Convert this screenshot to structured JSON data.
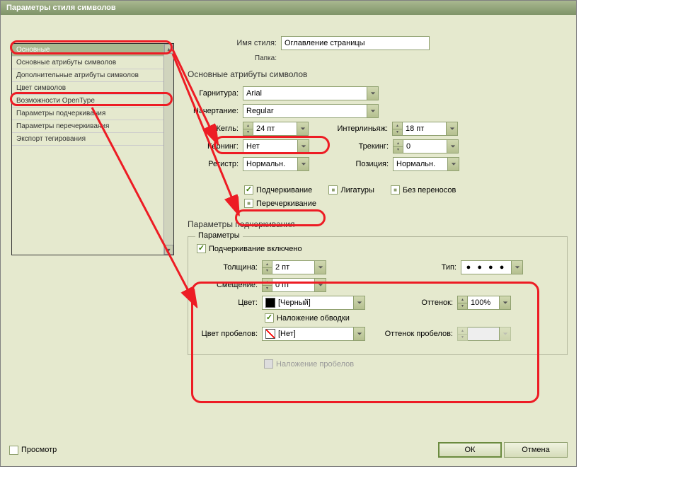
{
  "window": {
    "title": "Параметры стиля символов"
  },
  "sidebar": {
    "items": [
      {
        "label": "Основные"
      },
      {
        "label": "Основные атрибуты символов"
      },
      {
        "label": "Дополнительные атрибуты символов"
      },
      {
        "label": "Цвет символов"
      },
      {
        "label": "Возможности OpenType"
      },
      {
        "label": "Параметры подчеркивания"
      },
      {
        "label": "Параметры перечеркивания"
      },
      {
        "label": "Экспорт тегирования"
      }
    ]
  },
  "header": {
    "styleNameLabel": "Имя стиля:",
    "styleName": "Оглавление страницы",
    "folderLabel": "Папка:",
    "folder": ""
  },
  "sectionA": {
    "title": "Основные атрибуты символов",
    "fontLabel": "Гарнитура:",
    "font": "Arial",
    "styleLabel": "Начертание:",
    "style": "Regular",
    "sizeLabel": "Кегль:",
    "size": "24 пт",
    "leadingLabel": "Интерлиньяж:",
    "leading": "18 пт",
    "kerningLabel": "Кернинг:",
    "kerning": "Нет",
    "trackingLabel": "Трекинг:",
    "tracking": "0",
    "caseLabel": "Регистр:",
    "case": "Нормальн.",
    "positionLabel": "Позиция:",
    "position": "Нормальн.",
    "cb_underline": "Подчеркивание",
    "cb_ligatures": "Лигатуры",
    "cb_nobreak": "Без переносов",
    "cb_strike": "Перечеркивание"
  },
  "sectionB": {
    "title": "Параметры подчеркивания",
    "legend": "Параметры",
    "cb_on": "Подчеркивание включено",
    "weightLabel": "Толщина:",
    "weight": "2 пт",
    "offsetLabel": "Смещение:",
    "offset": "0 пт",
    "typeLabel": "Тип:",
    "colorLabel": "Цвет:",
    "color": "[Черный]",
    "tintLabel": "Оттенок:",
    "tint": "100%",
    "cb_overprint": "Наложение обводки",
    "gapColorLabel": "Цвет пробелов:",
    "gapColor": "[Нет]",
    "gapTintLabel": "Оттенок пробелов:",
    "gapTint": "",
    "cb_overprintGap": "Наложение пробелов"
  },
  "footer": {
    "preview": "Просмотр",
    "ok": "ОК",
    "cancel": "Отмена"
  }
}
